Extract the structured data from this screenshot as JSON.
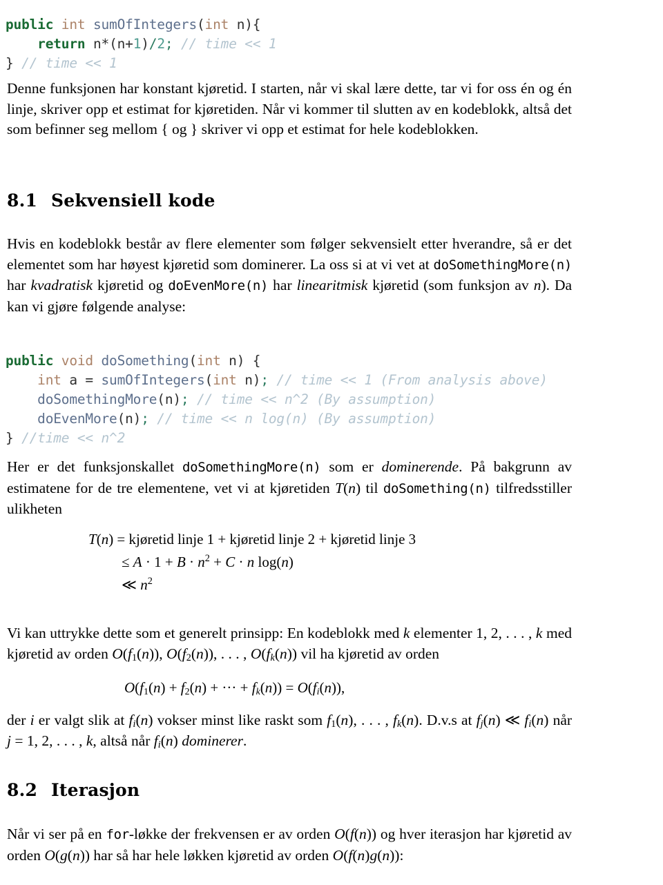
{
  "document": {
    "language": "Norwegian",
    "type": "lecture-notes-page"
  },
  "code_block_1": {
    "name": "sumOfIntegers-code",
    "lines": [
      {
        "tokens": [
          {
            "t": "public",
            "c": "kw"
          },
          {
            "t": " ",
            "c": "pun"
          },
          {
            "t": "int",
            "c": "typ"
          },
          {
            "t": " ",
            "c": "pun"
          },
          {
            "t": "sumOfIntegers",
            "c": "id"
          },
          {
            "t": "(",
            "c": "pun"
          },
          {
            "t": "int",
            "c": "typ"
          },
          {
            "t": " ",
            "c": "pun"
          },
          {
            "t": "n",
            "c": "pun"
          },
          {
            "t": "){",
            "c": "pun"
          }
        ]
      },
      {
        "tokens": [
          {
            "t": "    ",
            "c": "pun"
          },
          {
            "t": "return",
            "c": "kw"
          },
          {
            "t": " ",
            "c": "pun"
          },
          {
            "t": "n",
            "c": "pun"
          },
          {
            "t": "*",
            "c": "pun"
          },
          {
            "t": "(n+",
            "c": "pun"
          },
          {
            "t": "1",
            "c": "num"
          },
          {
            "t": ")",
            "c": "pun"
          },
          {
            "t": "/",
            "c": "op"
          },
          {
            "t": "2",
            "c": "num"
          },
          {
            "t": ";",
            "c": "op"
          },
          {
            "t": " ",
            "c": "pun"
          },
          {
            "t": "// time << 1",
            "c": "cmt"
          }
        ]
      },
      {
        "tokens": [
          {
            "t": "}",
            "c": "pun"
          },
          {
            "t": " ",
            "c": "pun"
          },
          {
            "t": "// time << 1",
            "c": "cmt"
          }
        ]
      }
    ]
  },
  "para_1": {
    "name": "paragraph-constant-runtime",
    "segments": [
      {
        "t": "Denne funksjonen har konstant kjøretid. I starten, når vi skal lære dette, tar vi for oss én og én linje, skriver opp et estimat for kjøretiden. Når vi kommer til slutten av en kodeblokk, altså det som befinner seg mellom ",
        "s": "rm"
      },
      {
        "t": "{",
        "s": "rm"
      },
      {
        "t": " og ",
        "s": "rm"
      },
      {
        "t": "}",
        "s": "rm"
      },
      {
        "t": " skriver vi opp et estimat for hele kodeblokken.",
        "s": "rm"
      }
    ],
    "text": "Denne funksjonen har konstant kjøretid. I starten, når vi skal lære dette, tar vi for oss én og én linje, skriver opp et estimat for kjøretiden. Når vi kommer til slutten av en kodeblokk, altså det som befinner seg mellom { og } skriver vi opp et estimat for hele kodeblokken."
  },
  "heading_81": {
    "number": "8.1",
    "title": "Sekvensiell kode"
  },
  "para_2": {
    "name": "paragraph-sequential-blocks",
    "text_parts": {
      "p1": "Hvis en kodeblokk består av flere elementer som følger sekvensielt etter hverandre, så er det elementet som har høyest kjøretid som dominerer. La oss si at vi vet at ",
      "code1": "doSomethingMore(n)",
      "p2": " har ",
      "em1": "kvadratisk",
      "p3": " kjøretid og ",
      "code2": "doEvenMore(n)",
      "p4": " har ",
      "em2": "linearitmisk",
      "p5": " kjøretid (som funksjon av ",
      "var1": "n",
      "p6": "). Da kan vi gjøre følgende analyse:"
    }
  },
  "code_block_2": {
    "name": "doSomething-code",
    "lines": [
      {
        "tokens": [
          {
            "t": "public",
            "c": "kw"
          },
          {
            "t": " ",
            "c": "pun"
          },
          {
            "t": "void",
            "c": "typ"
          },
          {
            "t": " ",
            "c": "pun"
          },
          {
            "t": "doSomething",
            "c": "id"
          },
          {
            "t": "(",
            "c": "pun"
          },
          {
            "t": "int",
            "c": "typ"
          },
          {
            "t": " n) {",
            "c": "pun"
          }
        ]
      },
      {
        "tokens": [
          {
            "t": "    ",
            "c": "pun"
          },
          {
            "t": "int",
            "c": "typ"
          },
          {
            "t": " a = ",
            "c": "pun"
          },
          {
            "t": "sumOfIntegers",
            "c": "id"
          },
          {
            "t": "(",
            "c": "pun"
          },
          {
            "t": "int",
            "c": "typ"
          },
          {
            "t": " n)",
            "c": "pun"
          },
          {
            "t": ";",
            "c": "op"
          },
          {
            "t": " ",
            "c": "pun"
          },
          {
            "t": "// time << 1 (From analysis above)",
            "c": "cmt"
          }
        ]
      },
      {
        "tokens": [
          {
            "t": "    ",
            "c": "pun"
          },
          {
            "t": "doSomethingMore",
            "c": "id"
          },
          {
            "t": "(n)",
            "c": "pun"
          },
          {
            "t": ";",
            "c": "op"
          },
          {
            "t": " ",
            "c": "pun"
          },
          {
            "t": "// time << n^2 (By assumption)",
            "c": "cmt"
          }
        ]
      },
      {
        "tokens": [
          {
            "t": "    ",
            "c": "pun"
          },
          {
            "t": "doEvenMore",
            "c": "id"
          },
          {
            "t": "(n)",
            "c": "pun"
          },
          {
            "t": ";",
            "c": "op"
          },
          {
            "t": " ",
            "c": "pun"
          },
          {
            "t": "// time << n log(n) (By assumption)",
            "c": "cmt"
          }
        ]
      },
      {
        "tokens": [
          {
            "t": "}",
            "c": "pun"
          },
          {
            "t": " ",
            "c": "pun"
          },
          {
            "t": "//time << n^2",
            "c": "cmt"
          }
        ]
      }
    ]
  },
  "para_3": {
    "name": "paragraph-dominating-call",
    "text_parts": {
      "p1": "Her er det funksjonskallet ",
      "code1": "doSomethingMore(n)",
      "p2": " som er ",
      "em1": "dominerende",
      "p3": ". På bakgrunn av estimatene for de tre elementene, vet vi at kjøretiden ",
      "math1": "T(n)",
      "p4": " til ",
      "code2": "doSomething(n)",
      "p5": " tilfredsstiller ulikheten"
    }
  },
  "eq_block_1": {
    "name": "inequality-display",
    "line1": "T(n) = kjøretid linje 1 + kjøretid linje 2 + kjøretid linje 3",
    "line2": "≤ A · 1 + B · n² + C · n log(n)",
    "line3": "≪ n²"
  },
  "para_4": {
    "name": "paragraph-general-principle",
    "text_parts": {
      "p1": "Vi kan uttrykke dette som et generelt prinsipp: En kodeblokk med ",
      "var_k": "k",
      "p2": " elementer ",
      "list": "1, 2, . . . , k",
      "p3": " med kjøretid av orden ",
      "orders": "O(f₁(n)), O(f₂(n)), . . . , O(f_k(n))",
      "p4": " vil ha kjøretid av orden"
    }
  },
  "eq_block_2": {
    "name": "big-o-sum-display",
    "text": "O(f₁(n) + f₂(n) + ··· + f_k(n)) = O(f_i(n)),"
  },
  "para_5": {
    "name": "paragraph-index-choice",
    "text_parts": {
      "p1": "der ",
      "var_i": "i",
      "p2": " er valgt slik at ",
      "fi": "f_i(n)",
      "p3": " vokser minst like raskt som ",
      "flist": "f₁(n), . . . , f_k(n)",
      "p4": ". D.v.s at ",
      "fj": "f_j(n)",
      "p5": " ≪ ",
      "fi2": "f_i(n)",
      "p6": " når ",
      "jlist": "j = 1, 2, . . . , k",
      "p7": ", altså når ",
      "fi3": "f_i(n)",
      "p8": " ",
      "em1": "dominerer",
      "p9": "."
    }
  },
  "heading_82": {
    "number": "8.2",
    "title": "Iterasjon"
  },
  "para_6": {
    "name": "paragraph-iteration-intro",
    "text_parts": {
      "p1": "Når vi ser på en ",
      "code1": "for",
      "p2": "-løkke der frekvensen er av orden ",
      "math1": "O(f(n))",
      "p3": " og hver iterasjon har kjøretid av orden ",
      "math2": "O(g(n))",
      "p4": " har så har hele løkken kjøretid av orden ",
      "math3": "O(f(n)g(n))",
      "p5": ":"
    }
  },
  "colors": {
    "keyword": "#1a6b34",
    "type": "#ab8267",
    "identifier": "#5d6f8c",
    "comment": "#b3c4cf",
    "number": "#4e9b8f",
    "operator": "#2a7a5e",
    "text": "#000000",
    "background": "#ffffff"
  }
}
